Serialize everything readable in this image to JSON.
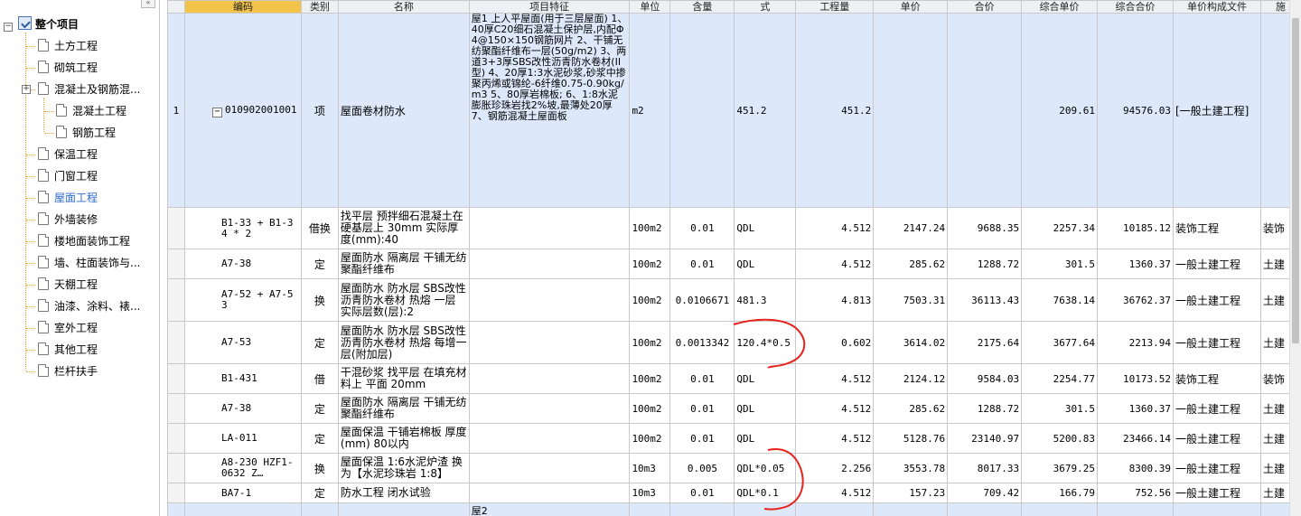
{
  "tree": {
    "collapse_label": "«",
    "root": "整个项目",
    "items": [
      {
        "label": "土方工程"
      },
      {
        "label": "砌筑工程"
      },
      {
        "label": "混凝土及钢筋混...",
        "expander": "+"
      },
      {
        "label": "混凝土工程"
      },
      {
        "label": "钢筋工程"
      },
      {
        "label": "保温工程"
      },
      {
        "label": "门窗工程"
      },
      {
        "label": "屋面工程",
        "selected": true
      },
      {
        "label": "外墙装修"
      },
      {
        "label": "楼地面装饰工程"
      },
      {
        "label": "墙、柱面装饰与..."
      },
      {
        "label": "天棚工程"
      },
      {
        "label": "油漆、涂料、裱..."
      },
      {
        "label": "室外工程"
      },
      {
        "label": "其他工程"
      },
      {
        "label": "栏杆扶手"
      }
    ],
    "root_expander": "−"
  },
  "grid": {
    "headers": [
      "",
      "编码",
      "类别",
      "名称",
      "项目特征",
      "单位",
      "含量",
      "式",
      "工程量",
      "单价",
      "合价",
      "综合单价",
      "综合合价",
      "单价构成文件",
      "施"
    ],
    "main_row": {
      "index": "1",
      "expander": "−",
      "code": "010902001001",
      "type": "项",
      "name": "屋面卷材防水",
      "features": "屋1\n上人平屋面(用于三层屋面)\n1、40厚C20细石混凝土保护层,内配Φ4@150×150钢筋网片\n2、干铺无纺聚酯纤维布一层(50g/m2)\n3、两道3+3厚SBS改性沥青防水卷材(II型)\n4、20厚1:3水泥砂浆,砂浆中掺聚丙烯或锦纶-6纤维0.75-0.90kg/m3\n5、80厚岩棉板;\n6、1:8水泥膨胀珍珠岩找2%坡,最薄处20厚\n7、钢筋混凝土屋面板",
      "unit": "m2",
      "content": "",
      "formula": "451.2",
      "qty": "451.2",
      "price": "",
      "amount": "",
      "comp_price": "209.61",
      "comp_amount": "94576.03",
      "file": "[一般土建工程]",
      "extra": ""
    },
    "rows": [
      {
        "code": "B1-33 + B1-34\n* 2",
        "type": "借换",
        "name": "找平层 预拌细石混凝土在硬基层上 30mm 实际厚度(mm):40",
        "unit": "100m2",
        "content": "0.01",
        "formula": "QDL",
        "qty": "4.512",
        "price": "2147.24",
        "amount": "9688.35",
        "comp_price": "2257.34",
        "comp_amount": "10185.12",
        "file": "装饰工程",
        "extra": "装饰"
      },
      {
        "code": "A7-38",
        "type": "定",
        "name": "屋面防水 隔离层 干铺无纺聚酯纤维布",
        "unit": "100m2",
        "content": "0.01",
        "formula": "QDL",
        "qty": "4.512",
        "price": "285.62",
        "amount": "1288.72",
        "comp_price": "301.5",
        "comp_amount": "1360.37",
        "file": "一般土建工程",
        "extra": "土建"
      },
      {
        "code": "A7-52 + A7-53",
        "type": "换",
        "name": "屋面防水 防水层 SBS改性沥青防水卷材 热熔 一层 实际层数(层):2",
        "unit": "100m2",
        "content": "0.0106671",
        "formula": "481.3",
        "qty": "4.813",
        "price": "7503.31",
        "amount": "36113.43",
        "comp_price": "7638.14",
        "comp_amount": "36762.37",
        "file": "一般土建工程",
        "extra": "土建"
      },
      {
        "code": "A7-53",
        "type": "定",
        "name": "屋面防水 防水层 SBS改性沥青防水卷材 热熔 每增一层(附加层)",
        "unit": "100m2",
        "content": "0.0013342",
        "formula": "120.4*0.5",
        "qty": "0.602",
        "price": "3614.02",
        "amount": "2175.64",
        "comp_price": "3677.64",
        "comp_amount": "2213.94",
        "file": "一般土建工程",
        "extra": "土建"
      },
      {
        "code": "B1-431",
        "type": "借",
        "name": "干混砂浆 找平层 在填充材料上 平面 20mm",
        "unit": "100m2",
        "content": "0.01",
        "formula": "QDL",
        "qty": "4.512",
        "price": "2124.12",
        "amount": "9584.03",
        "comp_price": "2254.77",
        "comp_amount": "10173.52",
        "file": "装饰工程",
        "extra": "装饰"
      },
      {
        "code": "A7-38",
        "type": "定",
        "name": "屋面防水 隔离层 干铺无纺聚酯纤维布",
        "unit": "100m2",
        "content": "0.01",
        "formula": "QDL",
        "qty": "4.512",
        "price": "285.62",
        "amount": "1288.72",
        "comp_price": "301.5",
        "comp_amount": "1360.37",
        "file": "一般土建工程",
        "extra": "土建"
      },
      {
        "code": "LA-011",
        "type": "定",
        "name": "屋面保温 干铺岩棉板 厚度(mm) 80以内",
        "unit": "100m2",
        "content": "0.01",
        "formula": "QDL",
        "qty": "4.512",
        "price": "5128.76",
        "amount": "23140.97",
        "comp_price": "5200.83",
        "comp_amount": "23466.14",
        "file": "一般土建工程",
        "extra": "土建"
      },
      {
        "code": "A8-230\nHZF1-0632 Z…",
        "type": "换",
        "name": "屋面保温 1:6水泥炉渣 换为【水泥珍珠岩 1:8】",
        "unit": "10m3",
        "content": "0.005",
        "formula": "QDL*0.05",
        "qty": "2.256",
        "price": "3553.78",
        "amount": "8017.33",
        "comp_price": "3679.25",
        "comp_amount": "8300.39",
        "file": "一般土建工程",
        "extra": "土建"
      },
      {
        "code": "BA7-1",
        "type": "定",
        "name": "防水工程 闭水试验",
        "unit": "10m3",
        "content": "0.01",
        "formula": "QDL*0.1",
        "qty": "4.512",
        "price": "157.23",
        "amount": "709.42",
        "comp_price": "166.79",
        "comp_amount": "752.56",
        "file": "一般土建工程",
        "extra": "土建"
      }
    ],
    "next_row": {
      "features": "屋2"
    }
  },
  "colors": {
    "highlight_row": "#dde9fb",
    "header_code": "#f3c44a",
    "annotation": "#e8221a",
    "tree_selected": "#2d6ad6"
  }
}
